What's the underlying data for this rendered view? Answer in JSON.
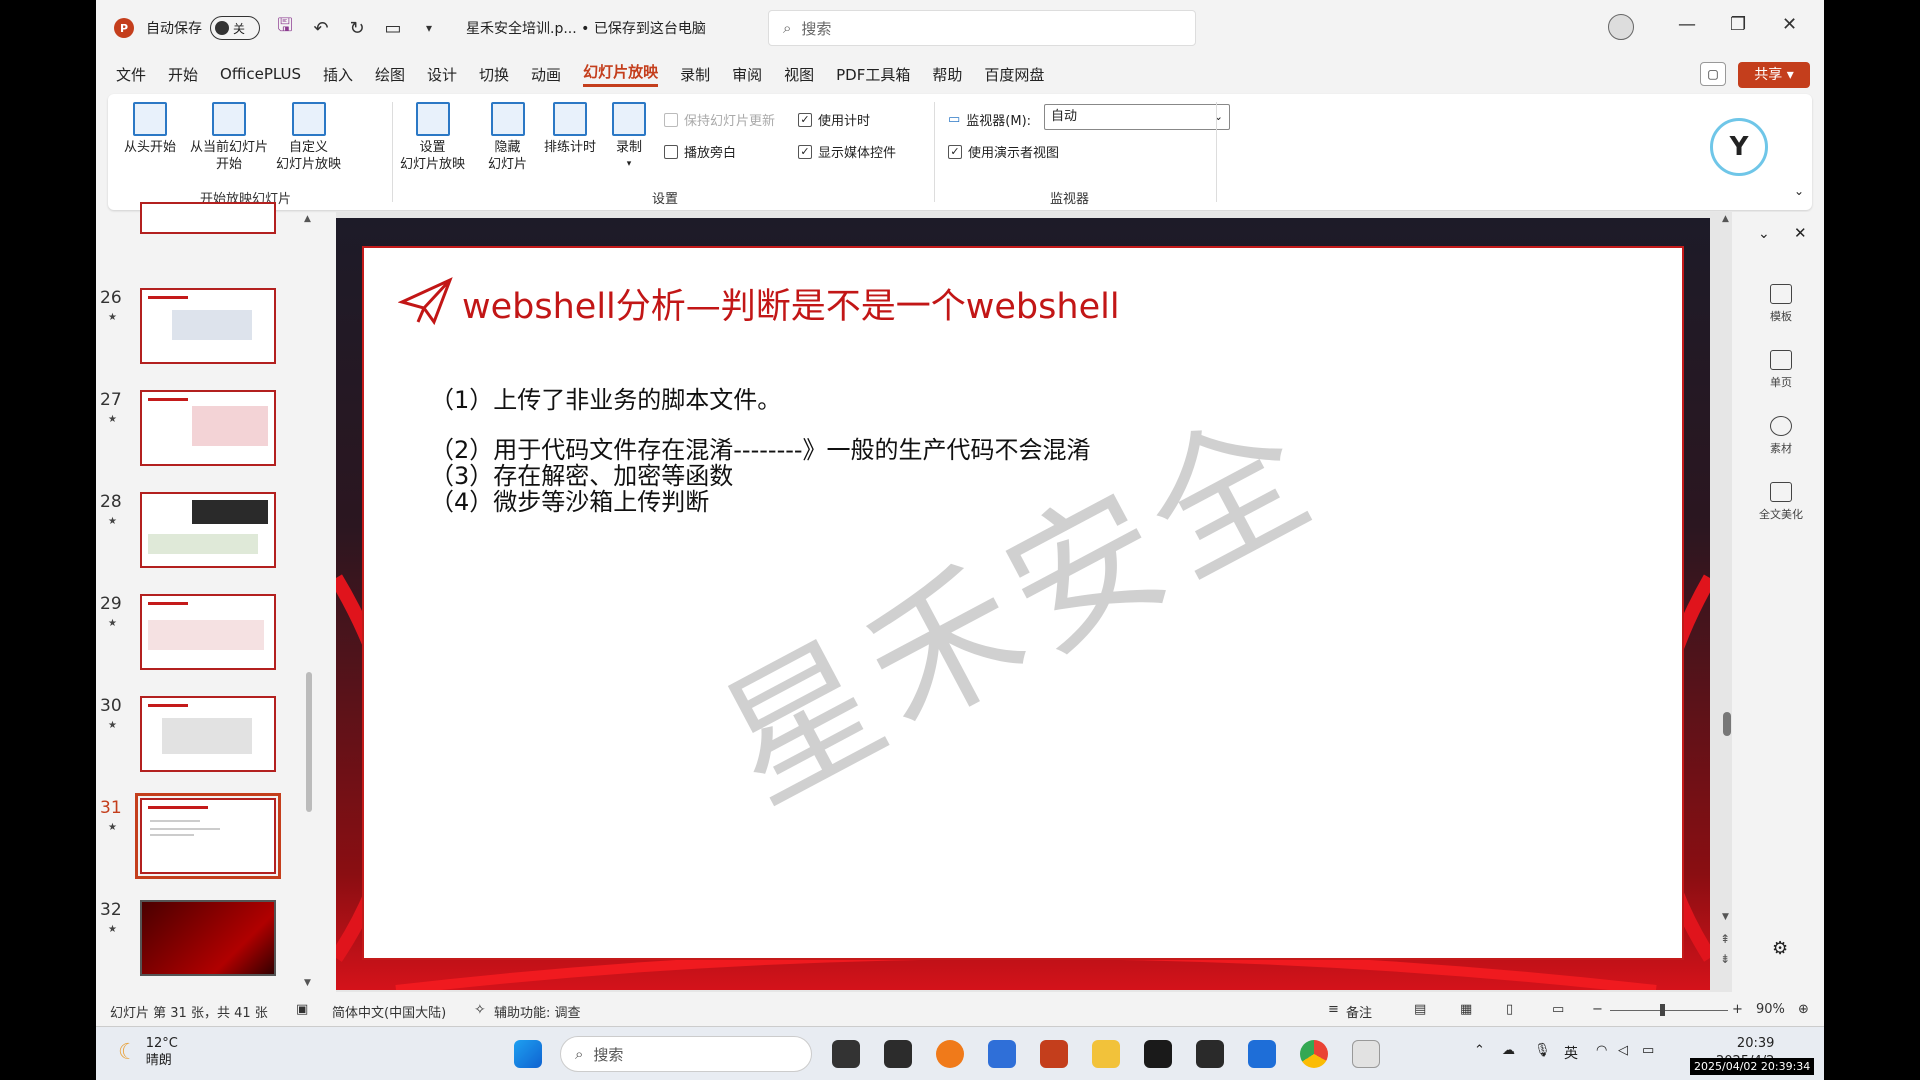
{
  "titlebar": {
    "autosave_label": "自动保存",
    "autosave_state": "关",
    "doc_title": "星禾安全培训.p... • 已保存到这台电脑",
    "search_placeholder": "搜索"
  },
  "menu": {
    "items": [
      "文件",
      "开始",
      "OfficePLUS",
      "插入",
      "绘图",
      "设计",
      "切换",
      "动画",
      "幻灯片放映",
      "录制",
      "审阅",
      "视图",
      "PDF工具箱",
      "帮助",
      "百度网盘"
    ],
    "active": "幻灯片放映",
    "share_label": "共享"
  },
  "ribbon": {
    "from_start": "从头开始",
    "from_current_1": "从当前幻灯片",
    "from_current_2": "开始",
    "custom_1": "自定义",
    "custom_2": "幻灯片放映",
    "group_start": "开始放映幻灯片",
    "setup_1": "设置",
    "setup_2": "幻灯片放映",
    "hide_1": "隐藏",
    "hide_2": "幻灯片",
    "rehearse": "排练计时",
    "record": "录制",
    "keep_updated": "保持幻灯片更新",
    "play_narration": "播放旁白",
    "use_timings": "使用计时",
    "show_media": "显示媒体控件",
    "group_setup": "设置",
    "monitor_label": "监视器(M):",
    "monitor_value": "自动",
    "presenter_view": "使用演示者视图",
    "group_monitor": "监视器"
  },
  "thumbnails": [
    {
      "num": "26"
    },
    {
      "num": "27"
    },
    {
      "num": "28"
    },
    {
      "num": "29"
    },
    {
      "num": "30"
    },
    {
      "num": "31"
    },
    {
      "num": "32"
    }
  ],
  "slide": {
    "title": "webshell分析—判断是不是一个webshell",
    "lines": [
      "（1）上传了非业务的脚本文件。",
      "（2）用于代码文件存在混淆--------》一般的生产代码不会混淆",
      "（3）存在解密、加密等函数",
      "（4）微步等沙箱上传判断"
    ],
    "watermark": "星禾安全"
  },
  "side_pane": {
    "items": [
      "模板",
      "单页",
      "素材",
      "全文美化"
    ]
  },
  "status": {
    "slide_info": "幻灯片 第 31 张，共 41 张",
    "language": "简体中文(中国大陆)",
    "accessibility": "辅助功能: 调查",
    "notes": "备注",
    "zoom": "90%"
  },
  "taskbar": {
    "temp": "12°C",
    "weather": "晴朗",
    "search_placeholder": "搜索",
    "ime": "英",
    "time": "20:39",
    "date": "2025/4/2",
    "timestamp": "2025/04/02 20:39:34"
  }
}
